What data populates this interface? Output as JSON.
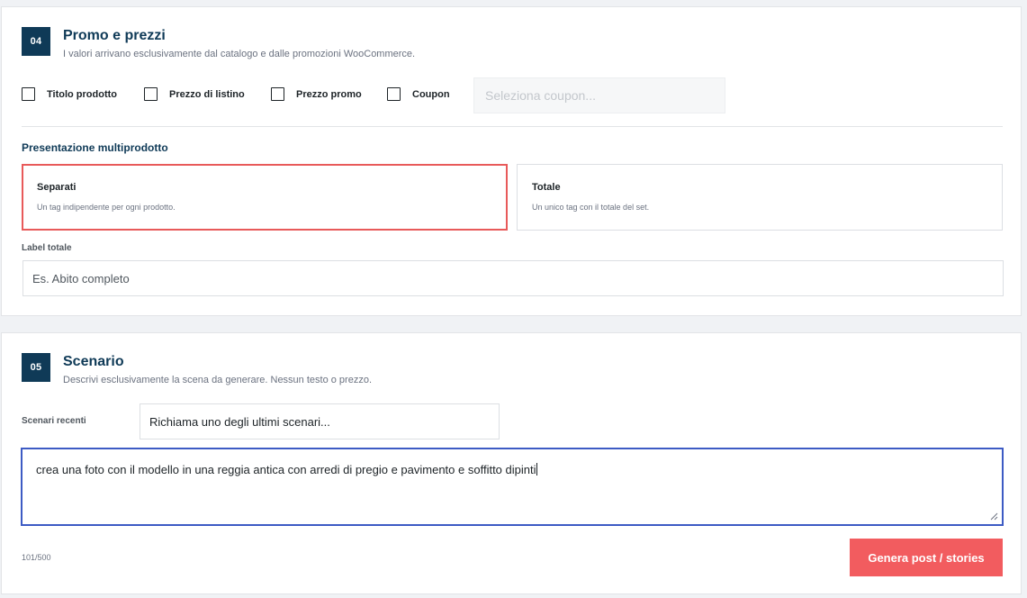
{
  "promo": {
    "step": "04",
    "title": "Promo e prezzi",
    "description": "I valori arrivano esclusivamente dal catalogo e dalle promozioni WooCommerce.",
    "checkboxes": [
      {
        "label": "Titolo prodotto",
        "checked": false
      },
      {
        "label": "Prezzo di listino",
        "checked": false
      },
      {
        "label": "Prezzo promo",
        "checked": false
      },
      {
        "label": "Coupon",
        "checked": false
      }
    ],
    "coupon_placeholder": "Seleziona coupon...",
    "multiproduct": {
      "heading": "Presentazione multiprodotto",
      "options": [
        {
          "title": "Separati",
          "description": "Un tag indipendente per ogni prodotto.",
          "selected": true
        },
        {
          "title": "Totale",
          "description": "Un unico tag con il totale del set.",
          "selected": false
        }
      ]
    },
    "total_label": {
      "label": "Label totale",
      "placeholder": "Es. Abito completo",
      "value": ""
    }
  },
  "scenario": {
    "step": "05",
    "title": "Scenario",
    "description": "Descrivi esclusivamente la scena da generare. Nessun testo o prezzo.",
    "recent_label": "Scenari recenti",
    "recent_select": "Richiama uno degli ultimi scenari...",
    "prompt_value": "crea una foto con il modello in una reggia antica con arredi di pregio e pavimento e soffitto dipinti",
    "char_count": "101/500",
    "generate_button": "Genera post / stories"
  },
  "colors": {
    "brand_dark": "#0f3a57",
    "accent_red": "#f25c5f",
    "selected_border": "#e85a5a",
    "focus_blue": "#3d5bc4"
  }
}
